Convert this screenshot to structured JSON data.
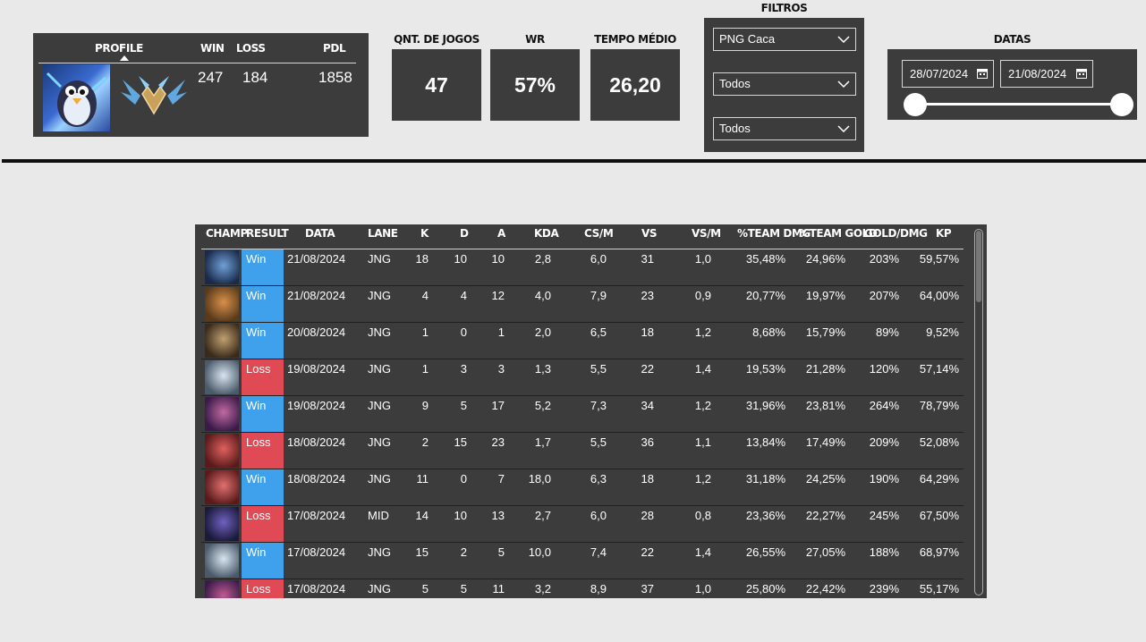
{
  "profile": {
    "label": "PROFILE",
    "win_label": "WIN",
    "loss_label": "LOSS",
    "pdl_label": "PDL",
    "win": "247",
    "loss": "184",
    "pdl": "1858",
    "avatar_icon": "penguin-avatar-icon",
    "rank_icon": "rank-emblem-icon"
  },
  "stats": {
    "games_label": "QNT. DE JOGOS",
    "games": "47",
    "wr_label": "WR",
    "wr": "57%",
    "time_label": "TEMPO MÉDIO",
    "time": "26,20"
  },
  "filters": {
    "title": "FILTROS",
    "account": "PNG Caca",
    "filter2": "Todos",
    "filter3": "Todos"
  },
  "dates": {
    "title": "DATAS",
    "start": "28/07/2024",
    "end": "21/08/2024"
  },
  "colors": {
    "win": "#3fa0ec",
    "loss": "#e04a55",
    "panel": "#3c3c3c"
  },
  "table": {
    "headers": [
      "CHAMP",
      "RESULT",
      "DATA",
      "LANE",
      "K",
      "D",
      "A",
      "KDA",
      "CS/M",
      "VS",
      "VS/M",
      "%TEAM DMG",
      "%TEAM GOLD",
      "GOLD/DMG",
      "KP"
    ],
    "rows": [
      {
        "result": "Win",
        "date": "21/08/2024",
        "lane": "JNG",
        "k": "18",
        "d": "10",
        "a": "10",
        "kda": "2,8",
        "csm": "6,0",
        "vs": "31",
        "vsm": "1,0",
        "dmg": "35,48%",
        "gold": "24,96%",
        "gd": "203%",
        "kp": "59,57%"
      },
      {
        "result": "Win",
        "date": "21/08/2024",
        "lane": "JNG",
        "k": "4",
        "d": "4",
        "a": "12",
        "kda": "4,0",
        "csm": "7,9",
        "vs": "23",
        "vsm": "0,9",
        "dmg": "20,77%",
        "gold": "19,97%",
        "gd": "207%",
        "kp": "64,00%"
      },
      {
        "result": "Win",
        "date": "20/08/2024",
        "lane": "JNG",
        "k": "1",
        "d": "0",
        "a": "1",
        "kda": "2,0",
        "csm": "6,5",
        "vs": "18",
        "vsm": "1,2",
        "dmg": "8,68%",
        "gold": "15,79%",
        "gd": "89%",
        "kp": "9,52%"
      },
      {
        "result": "Loss",
        "date": "19/08/2024",
        "lane": "JNG",
        "k": "1",
        "d": "3",
        "a": "3",
        "kda": "1,3",
        "csm": "5,5",
        "vs": "22",
        "vsm": "1,4",
        "dmg": "19,53%",
        "gold": "21,28%",
        "gd": "120%",
        "kp": "57,14%"
      },
      {
        "result": "Win",
        "date": "19/08/2024",
        "lane": "JNG",
        "k": "9",
        "d": "5",
        "a": "17",
        "kda": "5,2",
        "csm": "7,3",
        "vs": "34",
        "vsm": "1,2",
        "dmg": "31,96%",
        "gold": "23,81%",
        "gd": "264%",
        "kp": "78,79%"
      },
      {
        "result": "Loss",
        "date": "18/08/2024",
        "lane": "JNG",
        "k": "2",
        "d": "15",
        "a": "23",
        "kda": "1,7",
        "csm": "5,5",
        "vs": "36",
        "vsm": "1,1",
        "dmg": "13,84%",
        "gold": "17,49%",
        "gd": "209%",
        "kp": "52,08%"
      },
      {
        "result": "Win",
        "date": "18/08/2024",
        "lane": "JNG",
        "k": "11",
        "d": "0",
        "a": "7",
        "kda": "18,0",
        "csm": "6,3",
        "vs": "18",
        "vsm": "1,2",
        "dmg": "31,18%",
        "gold": "24,25%",
        "gd": "190%",
        "kp": "64,29%"
      },
      {
        "result": "Loss",
        "date": "17/08/2024",
        "lane": "MID",
        "k": "14",
        "d": "10",
        "a": "13",
        "kda": "2,7",
        "csm": "6,0",
        "vs": "28",
        "vsm": "0,8",
        "dmg": "23,36%",
        "gold": "22,27%",
        "gd": "245%",
        "kp": "67,50%"
      },
      {
        "result": "Win",
        "date": "17/08/2024",
        "lane": "JNG",
        "k": "15",
        "d": "2",
        "a": "5",
        "kda": "10,0",
        "csm": "7,4",
        "vs": "22",
        "vsm": "1,4",
        "dmg": "26,55%",
        "gold": "27,05%",
        "gd": "188%",
        "kp": "68,97%"
      },
      {
        "result": "Loss",
        "date": "17/08/2024",
        "lane": "JNG",
        "k": "5",
        "d": "5",
        "a": "11",
        "kda": "3,2",
        "csm": "8,9",
        "vs": "37",
        "vsm": "1,0",
        "dmg": "25,80%",
        "gold": "22,42%",
        "gd": "239%",
        "kp": "55,17%"
      }
    ]
  }
}
